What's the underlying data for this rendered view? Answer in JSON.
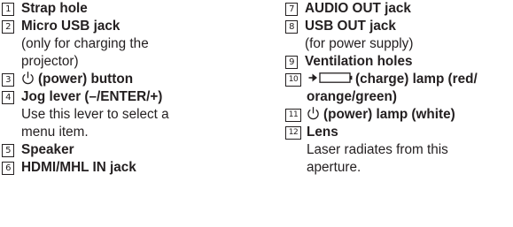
{
  "items": [
    {
      "n": "1",
      "title": "Strap hole"
    },
    {
      "n": "2",
      "title": "Micro USB jack",
      "desc1": "(only for charging the",
      "desc2": "projector)"
    },
    {
      "n": "3",
      "title": "(power) button",
      "icon": "power-icon"
    },
    {
      "n": "4",
      "title": "Jog lever (–/ENTER/+)",
      "desc1": "Use this lever to select a",
      "desc2": "menu item."
    },
    {
      "n": "5",
      "title": "Speaker"
    },
    {
      "n": "6",
      "title": "HDMI/MHL IN jack"
    },
    {
      "n": "7",
      "title": "AUDIO OUT jack"
    },
    {
      "n": "8",
      "title": "USB OUT jack",
      "desc1": "(for power supply)"
    },
    {
      "n": "9",
      "title": "Ventilation holes"
    },
    {
      "n": "10",
      "title1": "(charge) lamp (red/",
      "title2": "orange/green)",
      "icon": "charge-icon"
    },
    {
      "n": "11",
      "title": "(power) lamp (white)",
      "icon": "power-icon"
    },
    {
      "n": "12",
      "title": "Lens",
      "desc1": "Laser radiates from this",
      "desc2": "aperture."
    }
  ],
  "colors": {
    "text": "#231f20",
    "background": "#ffffff"
  }
}
